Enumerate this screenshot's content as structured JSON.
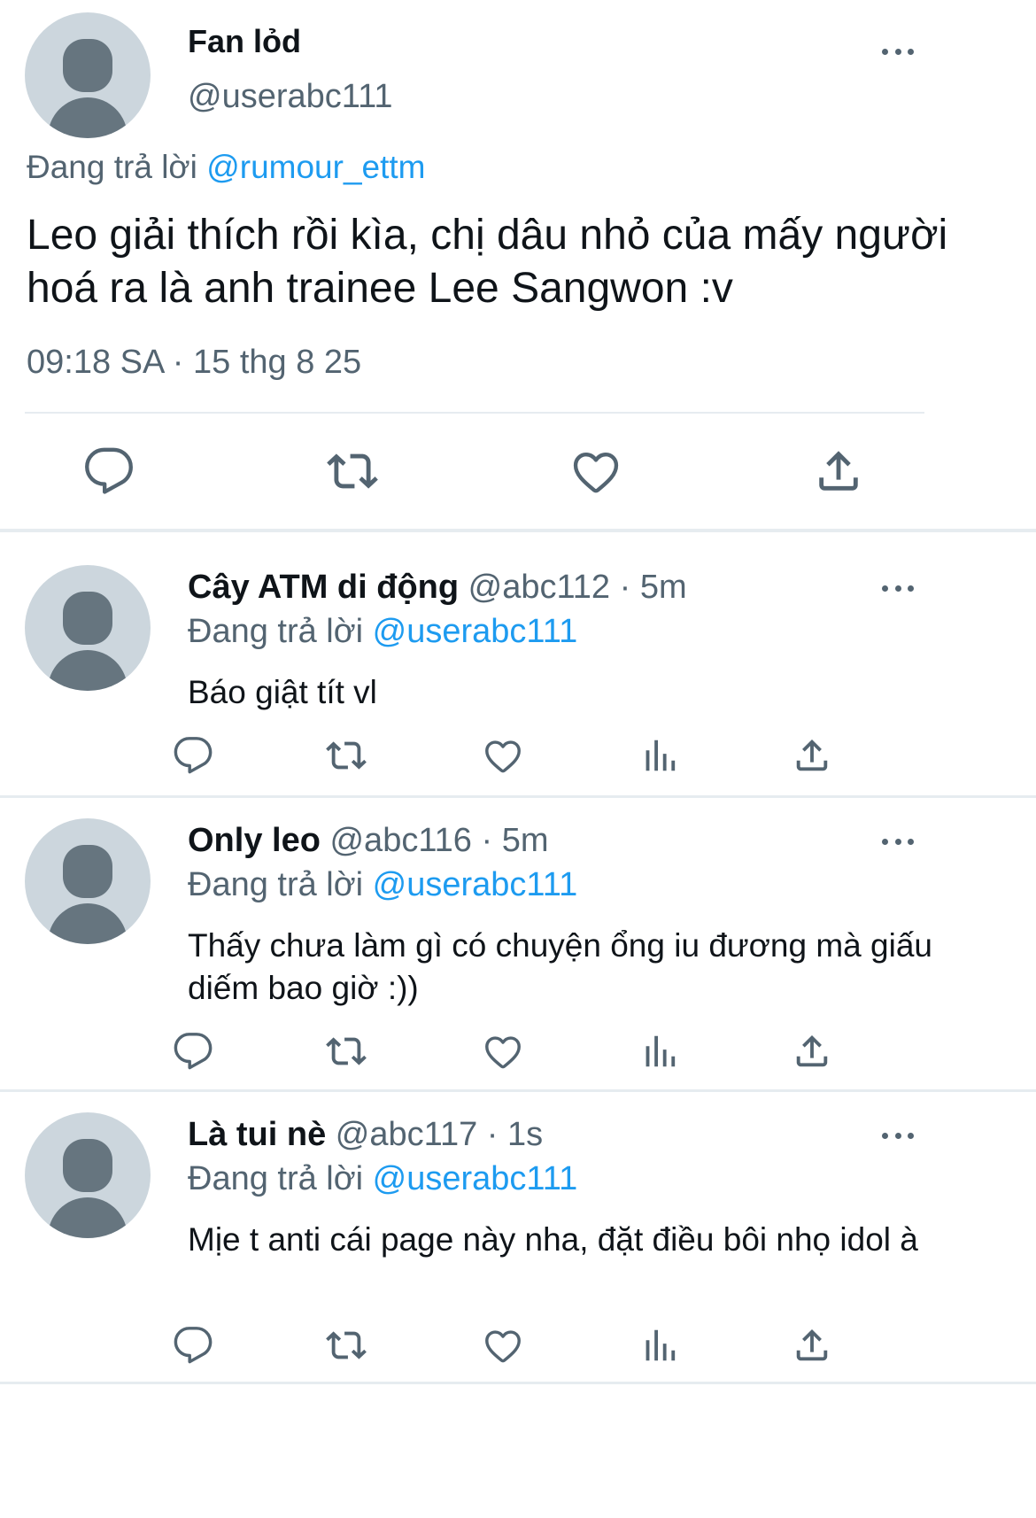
{
  "main_tweet": {
    "display_name": "Fan lỏd",
    "handle": "@userabc111",
    "replying_label": "Đang trả lời",
    "replying_to": "@rumour_ettm",
    "text": "Leo giải thích rồi kìa, chị dâu nhỏ của mấy người hoá ra là anh trainee Lee Sangwon :v",
    "timestamp": "09:18 SA · 15 thg 8 25",
    "actions": [
      "reply-icon",
      "retweet-icon",
      "like-icon",
      "share-icon"
    ]
  },
  "replies": [
    {
      "display_name": "Cây ATM di động",
      "handle": "@abc112",
      "time": "· 5m",
      "replying_label": "Đang trả lời",
      "replying_to": "@userabc111",
      "text": "Báo giật tít vl"
    },
    {
      "display_name": "Only leo",
      "handle": "@abc116",
      "time": "· 5m",
      "replying_label": "Đang trả lời",
      "replying_to": "@userabc111",
      "text": "Thấy chưa làm gì có chuyện ổng iu đương mà giấu diếm bao giờ :))"
    },
    {
      "display_name": "Là tui nè",
      "handle": "@abc117",
      "time": "· 1s",
      "replying_label": "Đang trả lời",
      "replying_to": "@userabc111",
      "text": "Mịe t anti cái page này nha, đặt điều bôi nhọ idol à"
    }
  ],
  "reply_actions": [
    "reply-icon",
    "retweet-icon",
    "like-icon",
    "views-icon",
    "share-icon"
  ],
  "colors": {
    "text": "#0f1419",
    "muted": "#536471",
    "link": "#1d9bf0",
    "avatar_bg": "#ccd6dd",
    "avatar_fg": "#66757f",
    "divider": "#e6ecf0"
  }
}
